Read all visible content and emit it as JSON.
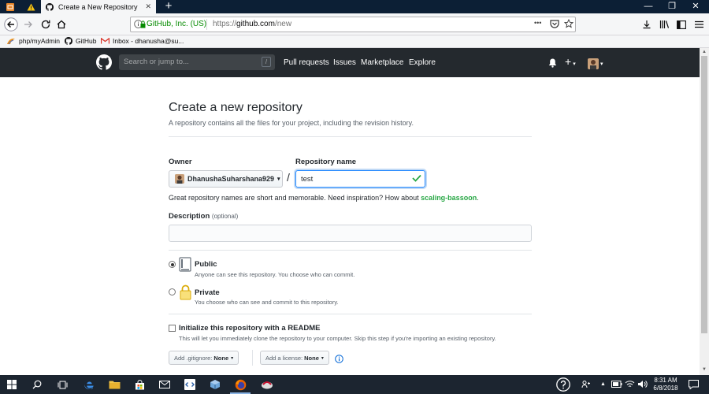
{
  "browser": {
    "active_tab_title": "Create a New Repository",
    "new_tab_symbol": "+",
    "identity": "GitHub, Inc. (US)",
    "url_prefix": "https://",
    "url_host": "github.com",
    "url_path": "/new",
    "more_symbol": "•••",
    "window_controls": {
      "minimize": "—",
      "maximize": "❐",
      "close": "✕"
    }
  },
  "bookmarks": [
    {
      "label": "php/myAdmin"
    },
    {
      "label": "GitHub"
    },
    {
      "label": "Inbox - dhanusha@su..."
    }
  ],
  "github_header": {
    "search_placeholder": "Search or jump to...",
    "search_key_hint": "/",
    "nav": [
      "Pull requests",
      "Issues",
      "Marketplace",
      "Explore"
    ],
    "plus_symbol": "+",
    "caret_symbol": "▾"
  },
  "page": {
    "title": "Create a new repository",
    "subtitle": "A repository contains all the files for your project, including the revision history.",
    "owner_label": "Owner",
    "owner_value": "DhanushaSuharshana929",
    "owner_caret": "▾",
    "separator": "/",
    "repo_name_label": "Repository name",
    "repo_name_value": "test",
    "hint_text": "Great repository names are short and memorable. Need inspiration? How about ",
    "suggestion": "scaling-bassoon",
    "hint_end": ".",
    "description_label": "Description",
    "description_optional": "(optional)",
    "visibility": {
      "public_title": "Public",
      "public_desc": "Anyone can see this repository. You choose who can commit.",
      "private_title": "Private",
      "private_desc": "You choose who can see and commit to this repository."
    },
    "readme_title": "Initialize this repository with a README",
    "readme_desc": "This will let you immediately clone the repository to your computer. Skip this step if you're importing an existing repository.",
    "gitignore_label": "Add .gitignore:",
    "gitignore_value": "None",
    "license_label": "Add a license:",
    "license_value": "None",
    "button_caret": "▾"
  },
  "taskbar": {
    "time": "8:31 AM",
    "date": "6/8/2018"
  },
  "colors": {
    "tab_strip": "#0c1f35",
    "github_header": "#24292e",
    "link_green": "#28a745",
    "focus_blue": "#2188ff",
    "taskbar": "#1c2530"
  }
}
